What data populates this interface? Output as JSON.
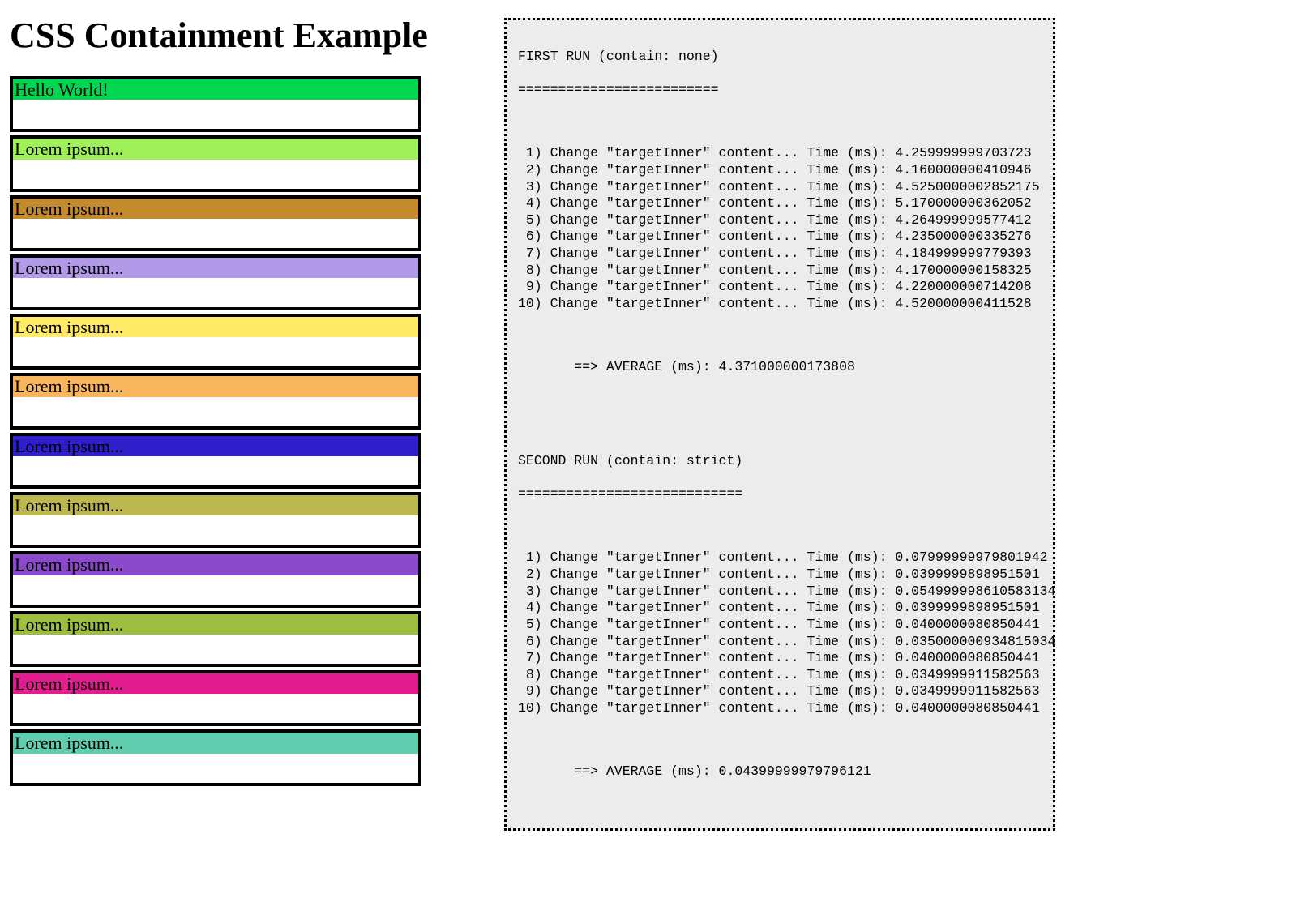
{
  "title": "CSS Containment Example",
  "items": [
    {
      "label": "Hello World!",
      "bg": "#00D64F"
    },
    {
      "label": "Lorem ipsum...",
      "bg": "#A0F05A"
    },
    {
      "label": "Lorem ipsum...",
      "bg": "#C38A2E"
    },
    {
      "label": "Lorem ipsum...",
      "bg": "#B29AE8"
    },
    {
      "label": "Lorem ipsum...",
      "bg": "#FFEB66"
    },
    {
      "label": "Lorem ipsum...",
      "bg": "#F7B55E"
    },
    {
      "label": "Lorem ipsum...",
      "bg": "#2E1FCB"
    },
    {
      "label": "Lorem ipsum...",
      "bg": "#BDB750"
    },
    {
      "label": "Lorem ipsum...",
      "bg": "#8A4AC9"
    },
    {
      "label": "Lorem ipsum...",
      "bg": "#9DBE3F"
    },
    {
      "label": "Lorem ipsum...",
      "bg": "#E21B8E"
    },
    {
      "label": "Lorem ipsum...",
      "bg": "#5FCDAE"
    }
  ],
  "log": {
    "run1": {
      "header": "FIRST RUN (contain: none)",
      "rule": "=========================",
      "lines": [
        " 1) Change \"targetInner\" content... Time (ms): 4.259999999703723",
        " 2) Change \"targetInner\" content... Time (ms): 4.160000000410946",
        " 3) Change \"targetInner\" content... Time (ms): 4.5250000002852175",
        " 4) Change \"targetInner\" content... Time (ms): 5.170000000362052",
        " 5) Change \"targetInner\" content... Time (ms): 4.264999999577412",
        " 6) Change \"targetInner\" content... Time (ms): 4.235000000335276",
        " 7) Change \"targetInner\" content... Time (ms): 4.184999999779393",
        " 8) Change \"targetInner\" content... Time (ms): 4.170000000158325",
        " 9) Change \"targetInner\" content... Time (ms): 4.220000000714208",
        "10) Change \"targetInner\" content... Time (ms): 4.520000000411528"
      ],
      "avg": "       ==> AVERAGE (ms): 4.371000000173808"
    },
    "run2": {
      "header": "SECOND RUN (contain: strict)",
      "rule": "============================",
      "lines": [
        " 1) Change \"targetInner\" content... Time (ms): 0.07999999979801942",
        " 2) Change \"targetInner\" content... Time (ms): 0.0399999898951501",
        " 3) Change \"targetInner\" content... Time (ms): 0.054999998610583134",
        " 4) Change \"targetInner\" content... Time (ms): 0.0399999898951501",
        " 5) Change \"targetInner\" content... Time (ms): 0.0400000080850441",
        " 6) Change \"targetInner\" content... Time (ms): 0.035000000934815034",
        " 7) Change \"targetInner\" content... Time (ms): 0.0400000080850441",
        " 8) Change \"targetInner\" content... Time (ms): 0.0349999911582563",
        " 9) Change \"targetInner\" content... Time (ms): 0.0349999911582563",
        "10) Change \"targetInner\" content... Time (ms): 0.0400000080850441"
      ],
      "avg": "       ==> AVERAGE (ms): 0.04399999979796121"
    }
  }
}
